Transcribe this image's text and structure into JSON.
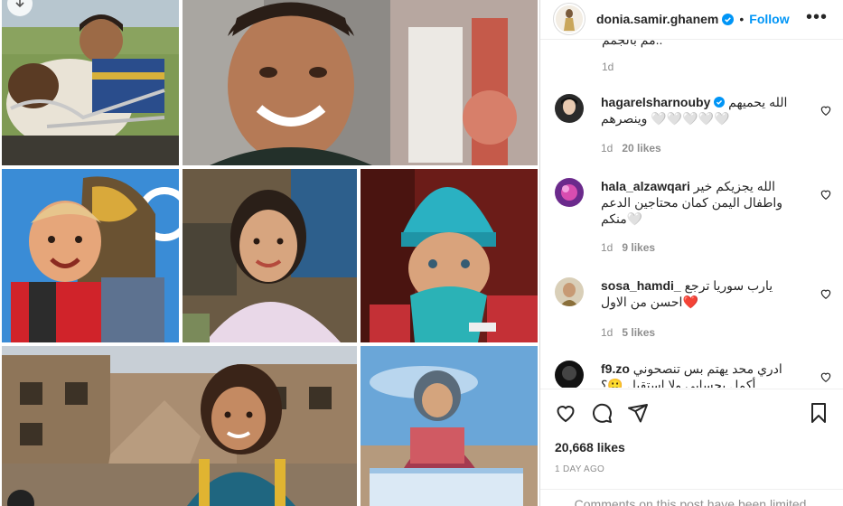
{
  "post": {
    "username": "donia.samir.ghanem",
    "follow_label": "Follow",
    "more_label": "•••",
    "separator": "•",
    "caption_fragment": "..مم بالجمم",
    "caption_time": "1d"
  },
  "comments": [
    {
      "username": "hagarelsharnouby",
      "verified": true,
      "text": "الله يحميهم وينصرهم 🤍🤍🤍🤍🤍",
      "time": "1d",
      "likes": "20 likes"
    },
    {
      "username": "hala_alzawqari",
      "verified": false,
      "text": "الله يجزيكم خير واطفال اليمن كمان محتاجين الدعم منكم🤍",
      "time": "1d",
      "likes": "9 likes"
    },
    {
      "username": "sosa_hamdi_",
      "verified": false,
      "text": "يارب سوريا ترجع احسن من الاول❤️",
      "time": "1d",
      "likes": "5 likes"
    },
    {
      "username": "f9.zo",
      "verified": false,
      "text": "ادري محد يهتم بس تنصحوني أكمل بحسابي ولا استقيل 🙂؟",
      "time": "",
      "likes": ""
    }
  ],
  "actions": {
    "like_icon": "heart-icon",
    "comment_icon": "comment-icon",
    "share_icon": "share-icon",
    "save_icon": "bookmark-icon",
    "likes_count": "20,668 likes",
    "time_ago": "1 DAY AGO",
    "limited_notice": "Comments on this post have been limited."
  },
  "colors": {
    "link_blue": "#0095f6",
    "verified_blue": "#0095f6",
    "muted": "#8e8e8e",
    "heart_red": "#ed4956"
  }
}
